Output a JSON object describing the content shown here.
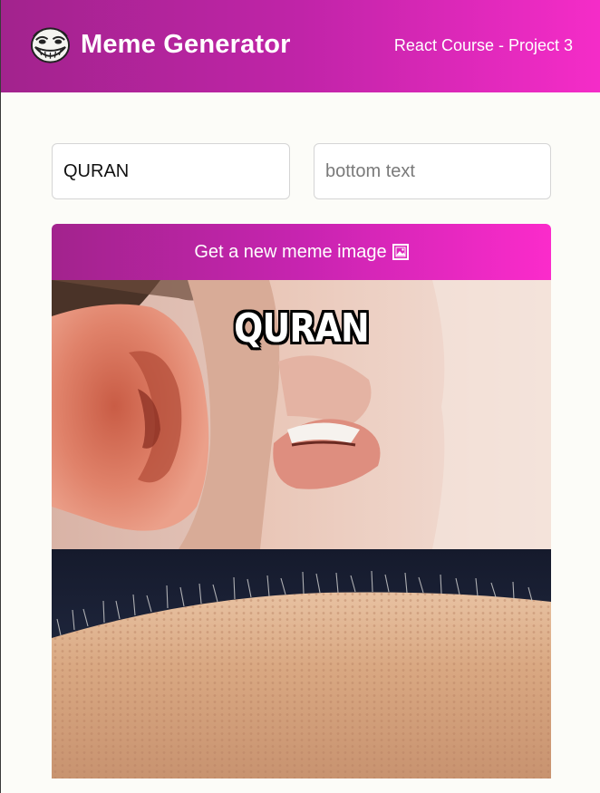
{
  "header": {
    "title": "Meme Generator",
    "course_label": "React Course - Project 3",
    "logo_icon": "troll-face-icon"
  },
  "form": {
    "top_text": {
      "value": "QURAN",
      "placeholder": "top text"
    },
    "bottom_text": {
      "value": "",
      "placeholder": "bottom text"
    },
    "button_label": "Get a new meme image",
    "button_icon": "framed-picture-icon"
  },
  "meme": {
    "top_text": "QURAN",
    "bottom_text": ""
  },
  "colors": {
    "gradient_start": "#a2238d",
    "gradient_end": "#f52cc8",
    "background": "#fcfcf8"
  }
}
